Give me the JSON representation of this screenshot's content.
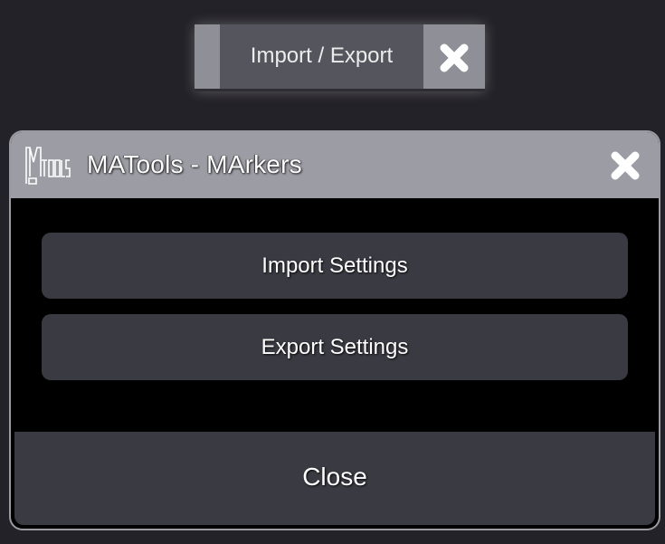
{
  "tab": {
    "label": "Import / Export",
    "close_icon": "close-x-icon"
  },
  "dialog": {
    "title": "MATools - MArkers",
    "logo": "matools-logo",
    "logo_text": "MA TOOLS",
    "close_icon": "close-x-icon",
    "buttons": {
      "import_label": "Import Settings",
      "export_label": "Export Settings"
    },
    "footer_label": "Close"
  },
  "colors": {
    "background": "#232228",
    "titlebar": "#9c9ca4",
    "button": "#3a3a42",
    "content_bg": "#000000",
    "tab_bg": "#55555d",
    "tab_accent": "#8f8f97",
    "text": "#ffffff"
  }
}
